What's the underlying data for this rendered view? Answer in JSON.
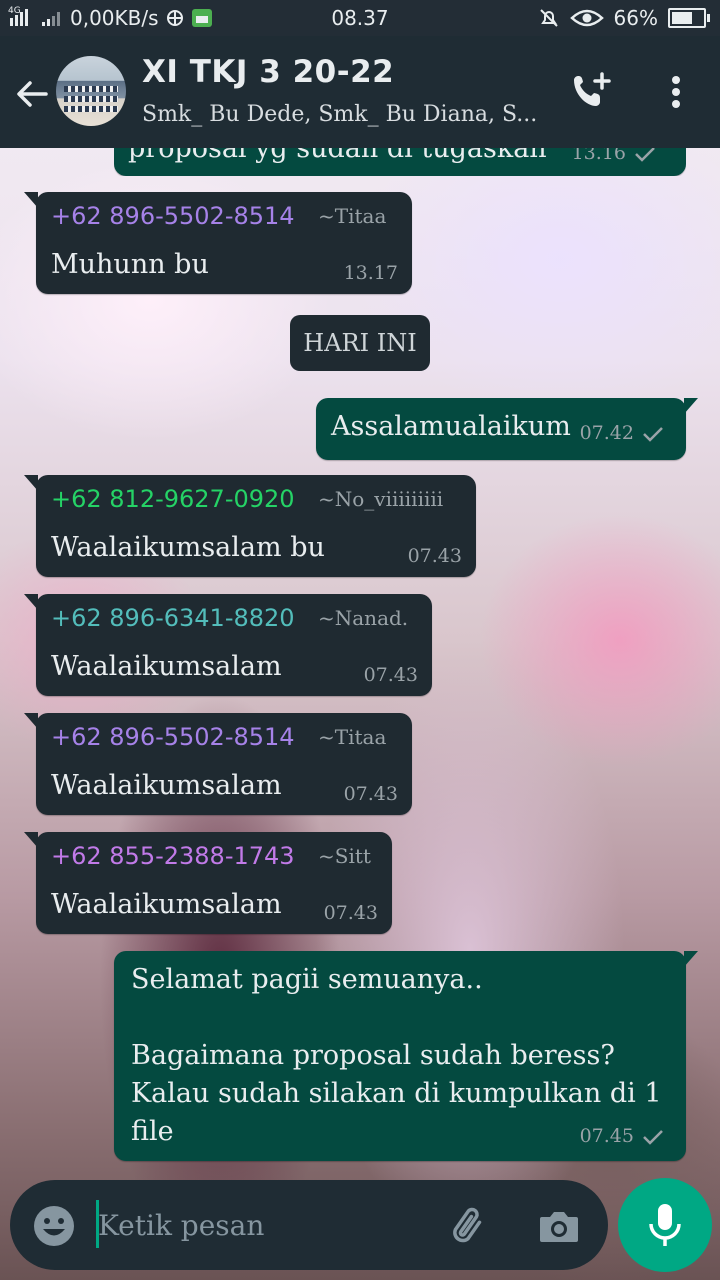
{
  "status_bar": {
    "network_type": "4G",
    "speed": "0,00KB/s",
    "time": "08.37",
    "battery": "66%",
    "battery_level": 0.66
  },
  "header": {
    "title": "XI TKJ 3 20-22",
    "subtitle": "Smk_ Bu Dede, Smk_ Bu Diana, S..."
  },
  "messages": [
    {
      "type": "out",
      "text": "proposal yg sudah di tugaskan",
      "time": "13.16"
    },
    {
      "type": "in",
      "sender": "+62 896-5502-8514",
      "alias": "~Titaa",
      "sender_color": "#a682e8",
      "text": "Muhunn bu",
      "time": "13.17"
    },
    {
      "type": "date",
      "text": "HARI INI"
    },
    {
      "type": "out",
      "text": "Assalamualaikum",
      "time": "07.42"
    },
    {
      "type": "in",
      "sender": "+62 812-9627-0920",
      "alias": "~No_viiiiiiiii",
      "sender_color": "#25d366",
      "text": "Waalaikumsalam bu",
      "time": "07.43"
    },
    {
      "type": "in",
      "sender": "+62 896-6341-8820",
      "alias": "~Nanad.",
      "sender_color": "#53bdbb",
      "text": "Waalaikumsalam",
      "time": "07.43"
    },
    {
      "type": "in",
      "sender": "+62 896-5502-8514",
      "alias": "~Titaa",
      "sender_color": "#a682e8",
      "text": "Waalaikumsalam",
      "time": "07.43"
    },
    {
      "type": "in",
      "sender": "+62 855-2388-1743",
      "alias": "~Sitt",
      "sender_color": "#c17ae8",
      "text": "Waalaikumsalam",
      "time": "07.43"
    },
    {
      "type": "out",
      "text": "Selamat pagii semuanya..\n\nBagaimana proposal sudah beress?\nKalau sudah silakan di kumpulkan di 1\nfile",
      "time": "07.45"
    }
  ],
  "input": {
    "placeholder": "Ketik pesan"
  },
  "icons": {
    "back": "arrow-left-icon",
    "add_call": "add-call-icon",
    "menu": "more-vert-icon",
    "emoji": "emoji-icon",
    "attach": "paperclip-icon",
    "camera": "camera-icon",
    "mic": "mic-icon"
  },
  "colors": {
    "accent": "#00a884",
    "header_bg": "#1f2c34",
    "incoming_bubble": "#1f2a31",
    "outgoing_bubble": "#044a40"
  }
}
